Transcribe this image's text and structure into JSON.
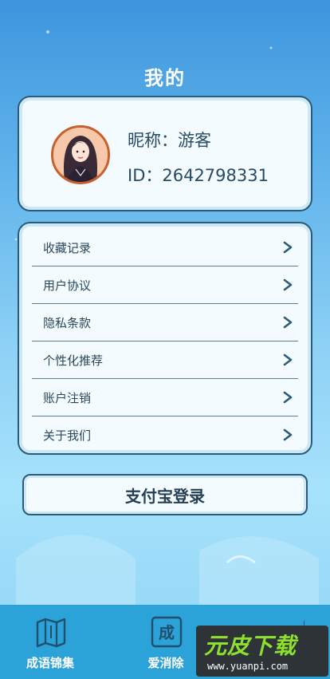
{
  "header": {
    "title": "我的"
  },
  "profile": {
    "nickname": "昵称：游客",
    "id_text": "ID：2642798331"
  },
  "menu": {
    "items": [
      {
        "label": "收藏记录"
      },
      {
        "label": "用户协议"
      },
      {
        "label": "隐私条款"
      },
      {
        "label": "个性化推荐"
      },
      {
        "label": "账户注销"
      },
      {
        "label": "关于我们"
      }
    ]
  },
  "login": {
    "label": "支付宝登录"
  },
  "tabbar": {
    "tabs": [
      {
        "label": "成语锦集",
        "icon": "map-book-icon"
      },
      {
        "label": "爱消除",
        "icon": "cheng-tile-icon",
        "icon_text": "成"
      },
      {
        "label": "",
        "icon": "bell-icon"
      }
    ]
  },
  "watermark": {
    "title": "元皮下载",
    "url": "www.yuanpi.com"
  },
  "colors": {
    "accent": "#2ba2d8",
    "border": "#2c5a77",
    "card_bg": "#f3fbfe"
  }
}
